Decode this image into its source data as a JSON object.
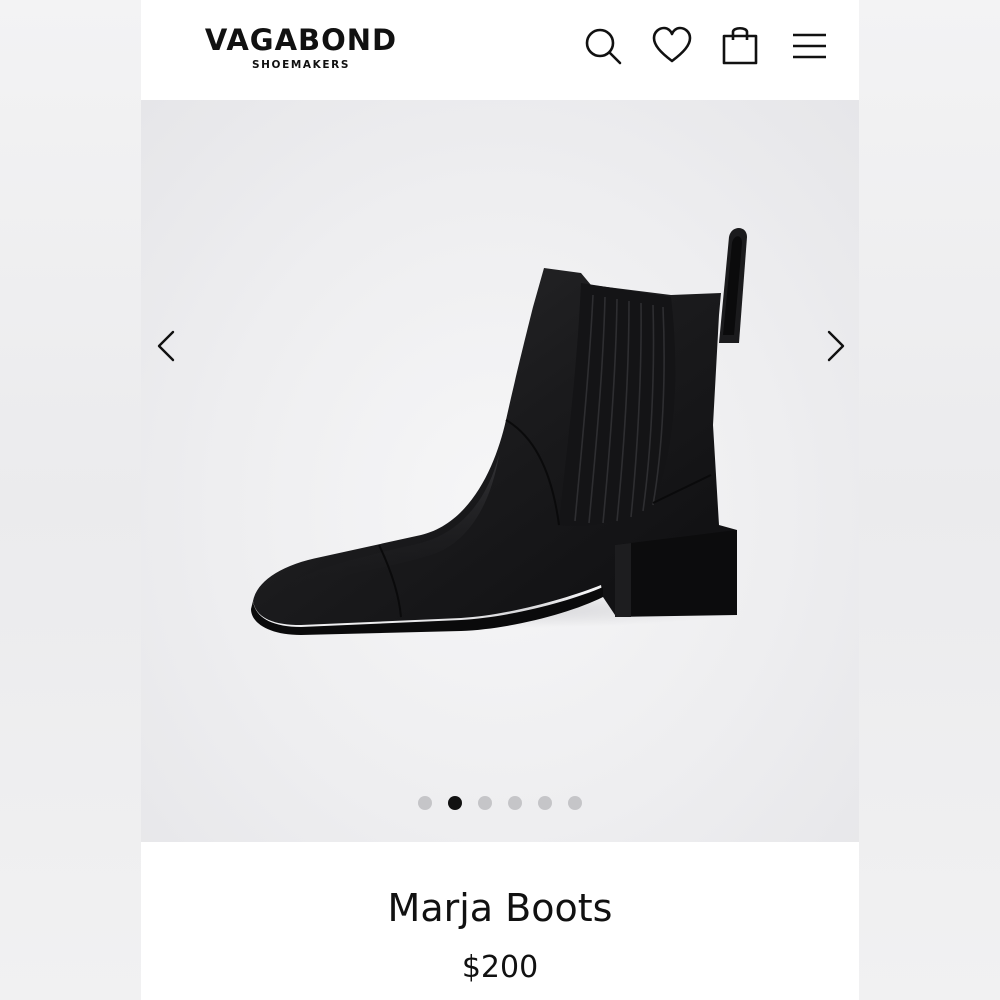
{
  "brand": {
    "name": "VAGABOND",
    "tagline": "SHOEMAKERS"
  },
  "header_icons": [
    "search-icon",
    "heart-icon",
    "shopping-bag-icon",
    "menu-icon"
  ],
  "gallery": {
    "image": "black leather chelsea boot",
    "slide_count": 6,
    "active_slide": 2,
    "prev_icon": "chevron-left-icon",
    "next_icon": "chevron-right-icon"
  },
  "product": {
    "name": "Marja Boots",
    "price": "$200"
  },
  "colors": {
    "text": "#111111",
    "gallery_bg": "#eeeef0",
    "dot_inactive": "#c5c5c8",
    "dot_active": "#111111"
  }
}
